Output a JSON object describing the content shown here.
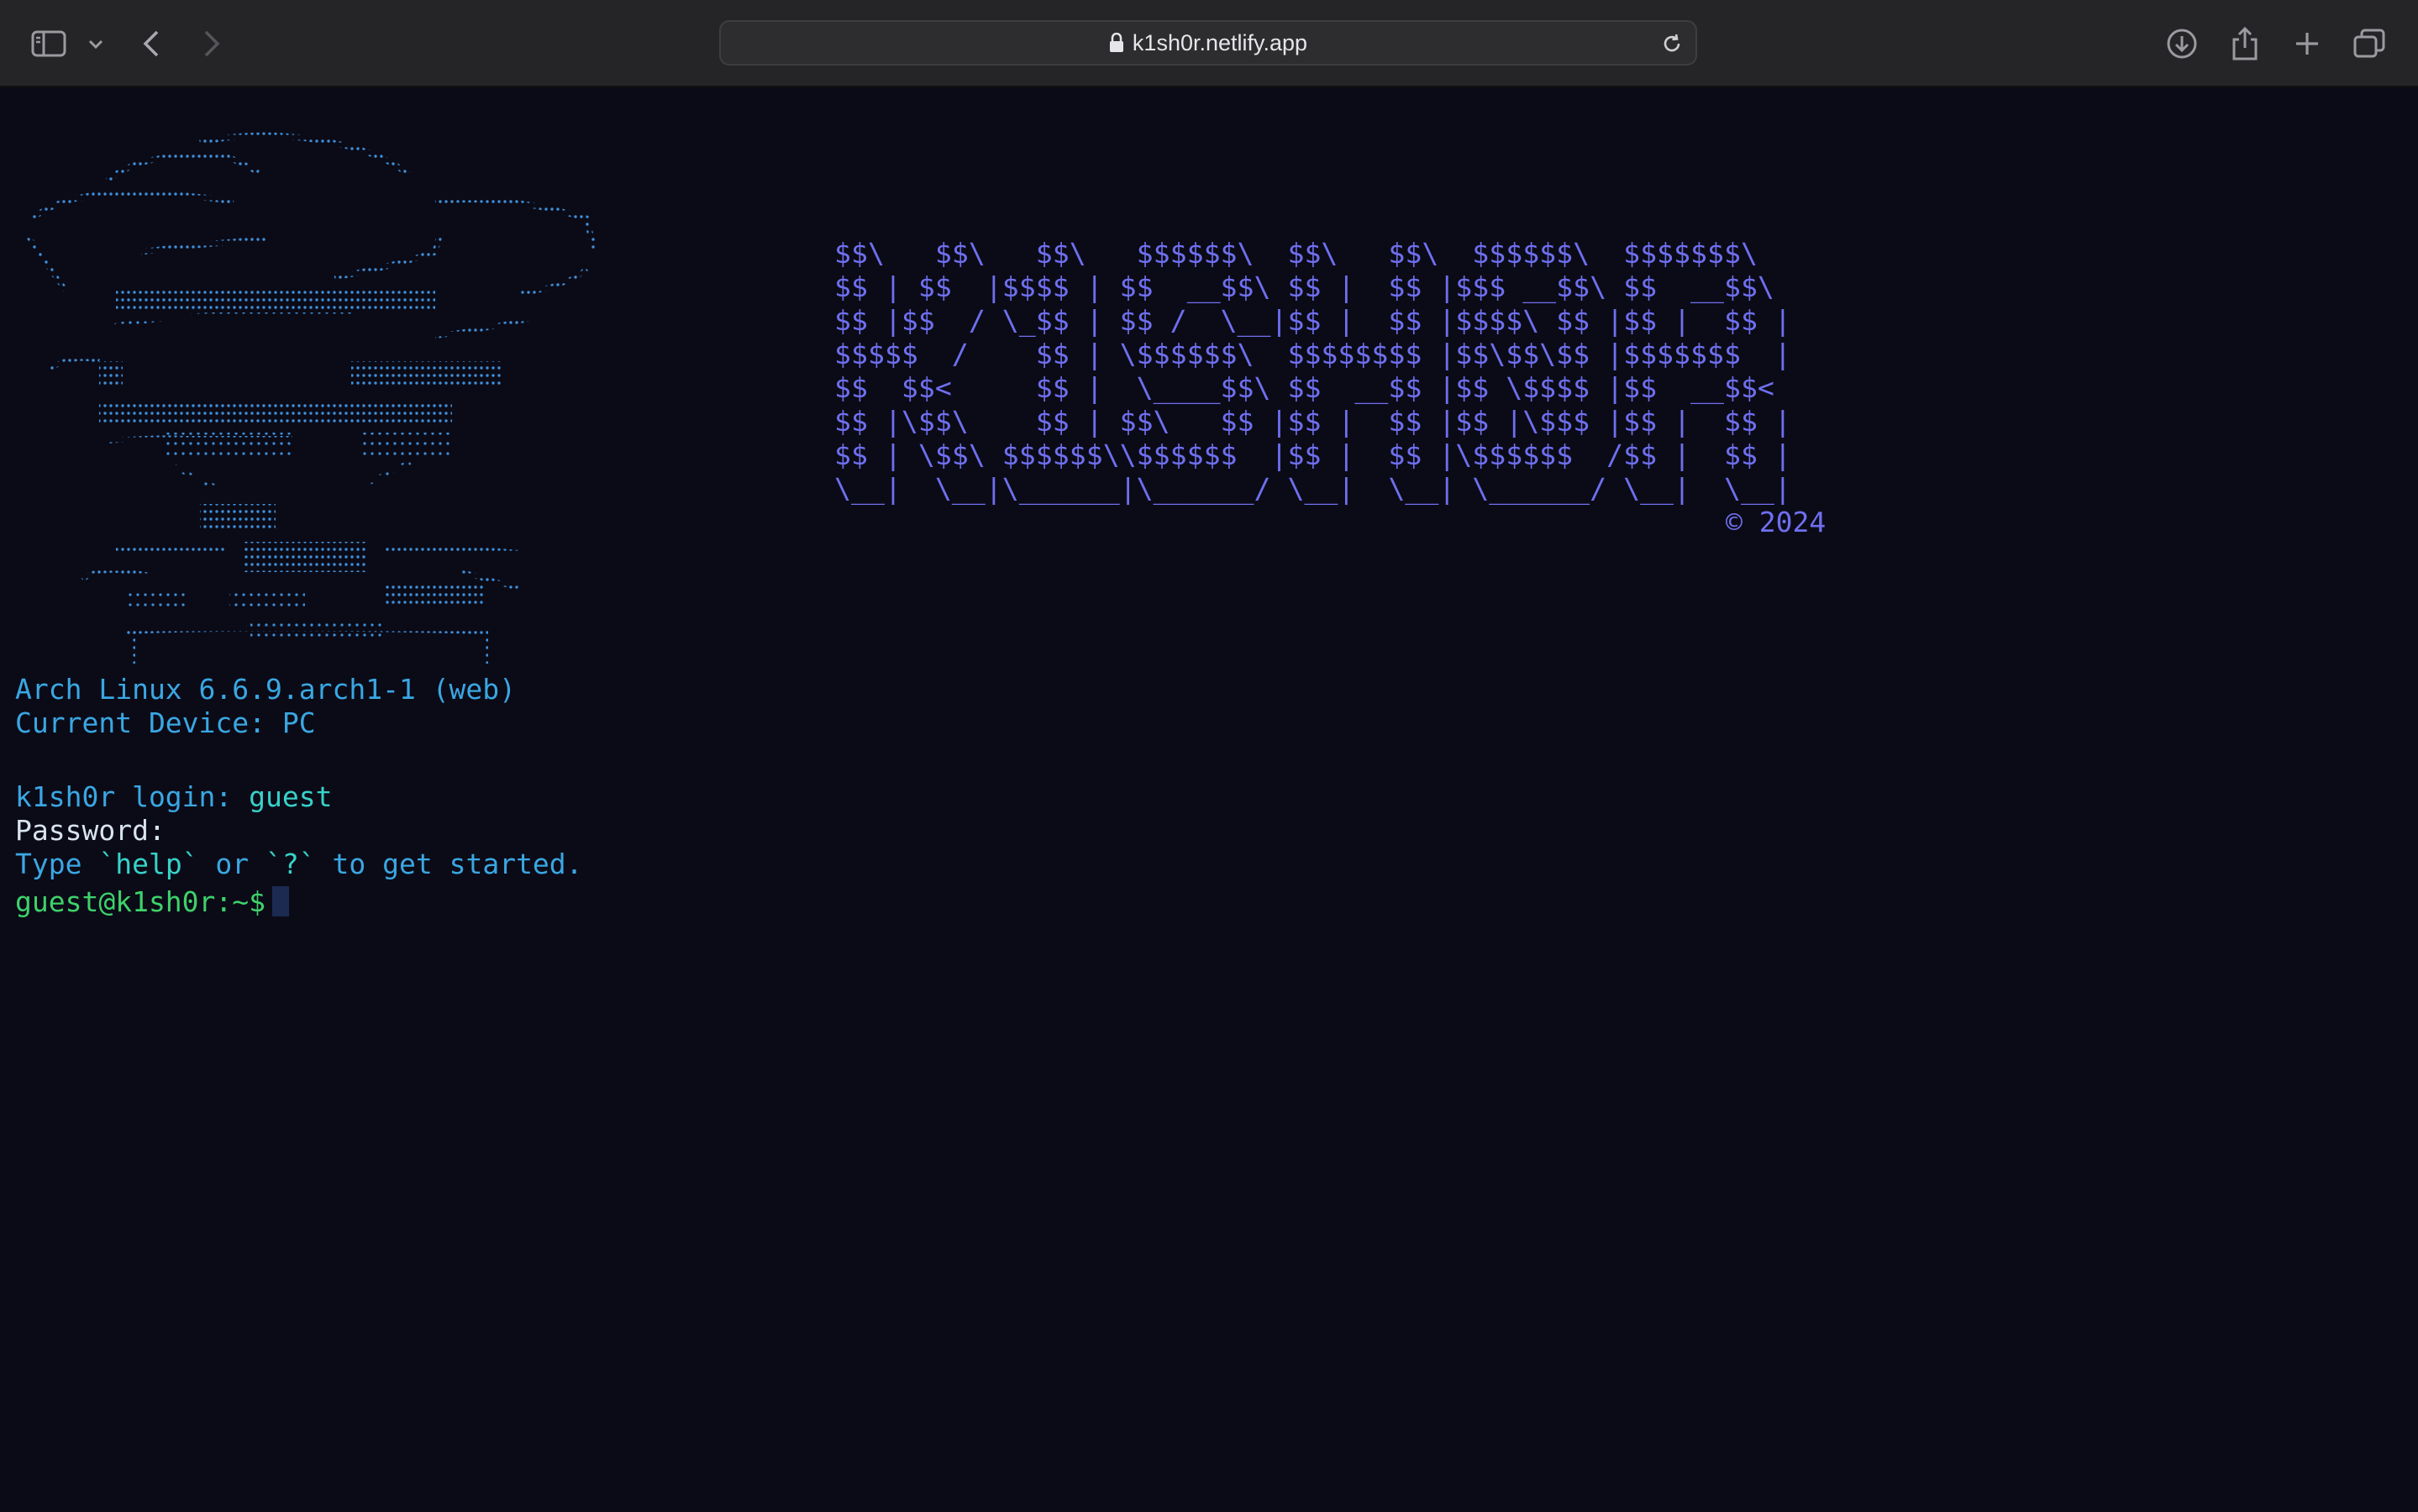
{
  "browser": {
    "url": "k1sh0r.netlify.app",
    "icons": {
      "sidebar": "sidebar-icon",
      "chevron": "chevron-down-icon",
      "back": "back-arrow-icon",
      "forward": "forward-arrow-icon",
      "lock": "lock-icon",
      "reload": "reload-icon",
      "download": "download-icon",
      "share": "share-icon",
      "new_tab": "plus-icon",
      "tabs": "tab-overview-icon"
    }
  },
  "terminal": {
    "banner_lines": [
      "$$\\   $$\\   $$\\   $$$$$$\\  $$\\   $$\\  $$$$$$\\  $$$$$$$\\",
      "$$ | $$  |$$$$ | $$  __$$\\ $$ |  $$ |$$$ __$$\\ $$  __$$\\",
      "$$ |$$  / \\_$$ | $$ /  \\__|$$ |  $$ |$$$$\\ $$ |$$ |  $$ |",
      "$$$$$  /    $$ | \\$$$$$$\\  $$$$$$$$ |$$\\$$\\$$ |$$$$$$$  |",
      "$$  $$<     $$ |  \\____$$\\ $$  __$$ |$$ \\$$$$ |$$  __$$<",
      "$$ |\\$$\\    $$ | $$\\   $$ |$$ |  $$ |$$ |\\$$$ |$$ |  $$ |",
      "$$ | \\$$\\ $$$$$$\\\\$$$$$$  |$$ |  $$ |\\$$$$$$  /$$ |  $$ |",
      "\\__|  \\__|\\______|\\______/ \\__|  \\__| \\______/ \\__|  \\__|"
    ],
    "copyright": "© 2024",
    "system_line": "Arch Linux 6.6.9.arch1-1 (web)",
    "device_line": "Current Device: PC",
    "login_label": "k1sh0r login:",
    "login_user": "guest",
    "password_label": "Password:",
    "hint_prefix": "Type ",
    "hint_help": "`help`",
    "hint_or": " or ",
    "hint_q": "`?`",
    "hint_suffix": " to get started.",
    "prompt": "guest@k1sh0r:~$",
    "logo_art": "arch-linux-cat-braille-ascii-art"
  },
  "colors": {
    "background": "#0b0b17",
    "banner": "#6f6ff0",
    "text_blue": "#3aa7e3",
    "text_teal": "#37d2c9",
    "prompt_green": "#3ed26a"
  }
}
